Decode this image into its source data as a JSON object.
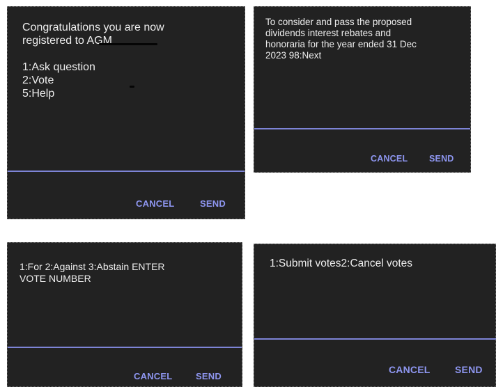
{
  "colors": {
    "dialog_background": "#222222",
    "message_text": "#ededed",
    "accent": "#8e96f0",
    "divider": "#7d84d6",
    "redaction": "#050505"
  },
  "dialogs": [
    {
      "message": "Congratulations you are now\nregistered to                        AGM\n\n1:Ask question\n2:Vote\n5:Help",
      "cancel_label": "CANCEL",
      "send_label": "SEND"
    },
    {
      "message": "To consider and pass the proposed\ndividends interest rebates and\nhonoraria for the year ended 31 Dec\n2023 98:Next",
      "cancel_label": "CANCEL",
      "send_label": "SEND"
    },
    {
      "message": "1:For 2:Against 3:Abstain ENTER\nVOTE NUMBER",
      "cancel_label": "CANCEL",
      "send_label": "SEND"
    },
    {
      "message": "1:Submit votes2:Cancel votes",
      "cancel_label": "CANCEL",
      "send_label": "SEND"
    }
  ]
}
